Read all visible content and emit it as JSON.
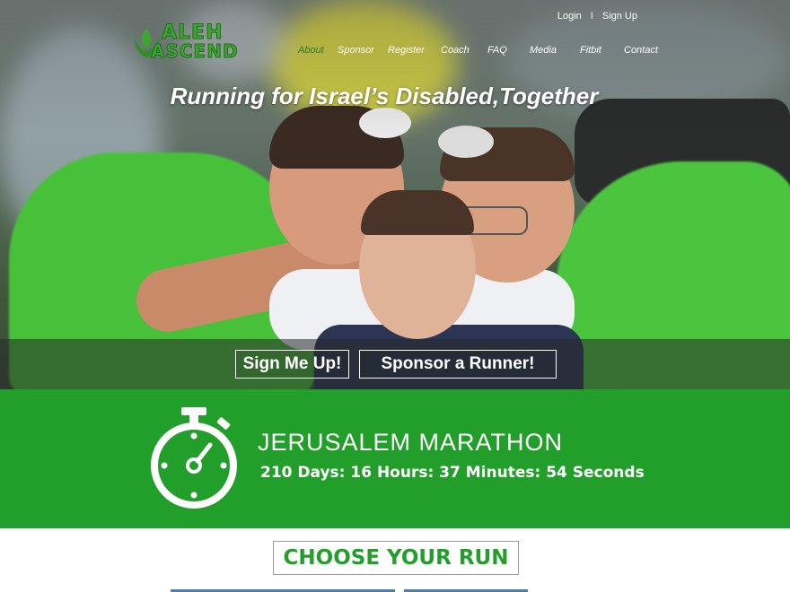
{
  "header": {
    "logo_line1": "ALEH",
    "logo_line2": "ASCEND",
    "util_links": {
      "login": "Login",
      "separator": "I",
      "signup": "Sign Up"
    },
    "nav": [
      {
        "label": "About",
        "active": true
      },
      {
        "label": "Sponsor",
        "active": false
      },
      {
        "label": "Register",
        "active": false
      },
      {
        "label": "Coach",
        "active": false
      },
      {
        "label": "FAQ",
        "active": false
      },
      {
        "label": "Media",
        "active": false
      },
      {
        "label": "Fitbit",
        "active": false
      },
      {
        "label": "Contact",
        "active": false
      }
    ]
  },
  "hero": {
    "headline": "Running for Israel’s Disabled,Together",
    "cta_primary": "Sign Me Up!",
    "cta_secondary": "Sponsor a Runner!"
  },
  "countdown": {
    "icon": "stopwatch-icon",
    "title": "JERUSALEM MARATHON",
    "time": "210 Days: 16 Hours: 37 Minutes: 54 Seconds"
  },
  "main": {
    "choose_label": "CHOOSE YOUR RUN"
  },
  "colors": {
    "brand_green": "#229e2a",
    "logo_green": "#3da632",
    "nav_active": "#2d7a24",
    "white": "#ffffff"
  }
}
